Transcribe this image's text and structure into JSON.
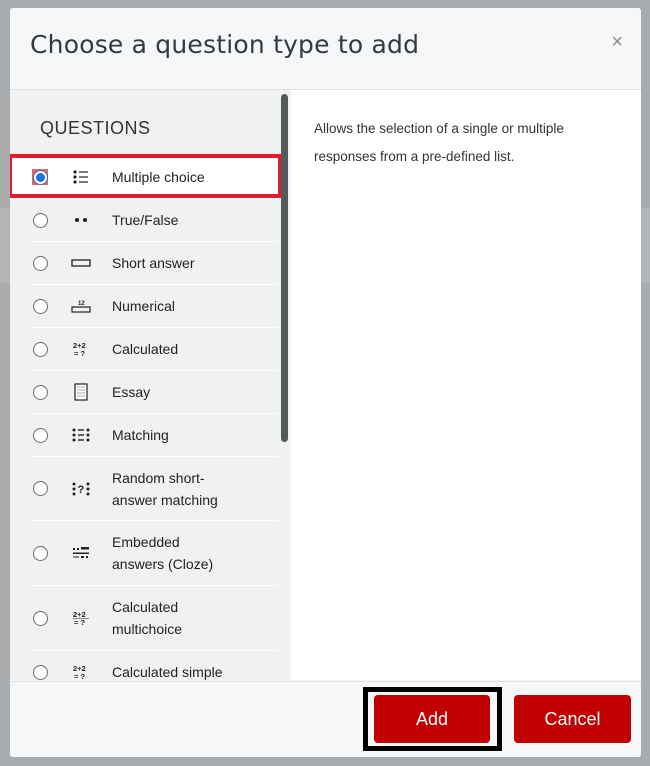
{
  "modal": {
    "title": "Choose a question type to add",
    "close_icon": "×"
  },
  "questions": {
    "heading": "QUESTIONS",
    "items": [
      {
        "label": "Multiple choice",
        "icon": "multiple-choice-icon",
        "selected": true
      },
      {
        "label": "True/False",
        "icon": "true-false-icon",
        "selected": false
      },
      {
        "label": "Short answer",
        "icon": "short-answer-icon",
        "selected": false
      },
      {
        "label": "Numerical",
        "icon": "numerical-icon",
        "selected": false
      },
      {
        "label": "Calculated",
        "icon": "calculated-icon",
        "selected": false
      },
      {
        "label": "Essay",
        "icon": "essay-icon",
        "selected": false
      },
      {
        "label": "Matching",
        "icon": "matching-icon",
        "selected": false
      },
      {
        "label": "Random short-answer matching",
        "label_line1": "Random short-",
        "label_line2": "answer matching",
        "icon": "random-matching-icon",
        "selected": false
      },
      {
        "label": "Embedded answers (Cloze)",
        "label_line1": "Embedded",
        "label_line2": "answers (Cloze)",
        "icon": "cloze-icon",
        "selected": false
      },
      {
        "label": "Calculated multichoice",
        "label_line1": "Calculated",
        "label_line2": "multichoice",
        "icon": "calculated-multichoice-icon",
        "selected": false
      },
      {
        "label": "Calculated simple",
        "icon": "calculated-simple-icon",
        "selected": false
      }
    ]
  },
  "description": "Allows the selection of a single or multiple responses from a pre-defined list.",
  "footer": {
    "add_label": "Add",
    "cancel_label": "Cancel"
  },
  "colors": {
    "primary_button": "#c00000",
    "highlight": "#e21c2a",
    "radio_selected": "#1a73e8"
  }
}
